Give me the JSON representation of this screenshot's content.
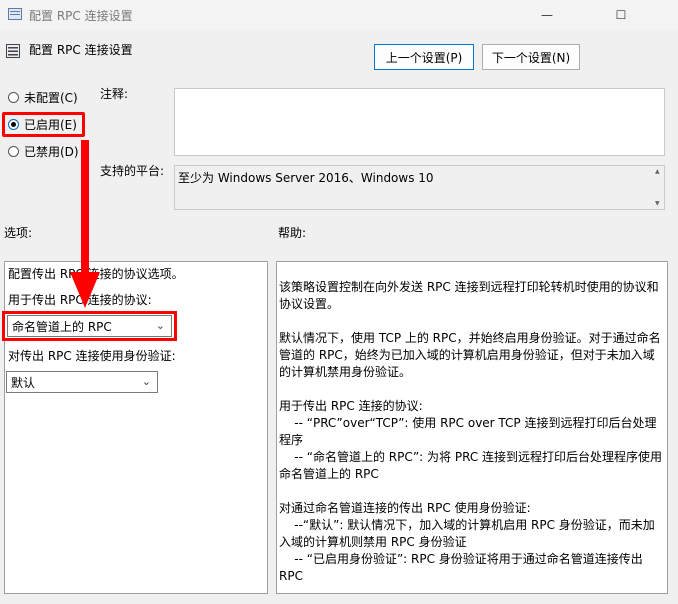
{
  "window": {
    "title": "配置 RPC 连接设置",
    "minimize_glyph": "—",
    "maximize_glyph": "☐"
  },
  "header": {
    "title": "配置 RPC 连接设置",
    "prev_button": "上一个设置(P)",
    "next_button": "下一个设置(N)"
  },
  "state": {
    "options": [
      {
        "label": "未配置(C)",
        "selected": false
      },
      {
        "label": "已启用(E)",
        "selected": true
      },
      {
        "label": "已禁用(D)",
        "selected": false
      }
    ]
  },
  "comment": {
    "label": "注释:",
    "value": ""
  },
  "platform": {
    "label": "支持的平台:",
    "value": "至少为 Windows Server 2016、Windows 10"
  },
  "options_panel": {
    "label": "选项:",
    "description": "配置传出 RPC 连接的协议选项。",
    "protocol_label": "用于传出 RPC 连接的协议:",
    "protocol_value": "命名管道上的 RPC",
    "auth_label": "对传出 RPC 连接使用身份验证:",
    "auth_value": "默认"
  },
  "help_panel": {
    "label": "帮助:",
    "text": "该策略设置控制在向外发送 RPC 连接到远程打印轮转机时使用的协议和协议设置。\n\n默认情况下，使用 TCP 上的 RPC，并始终启用身份验证。对于通过命名管道的 RPC，始终为已加入域的计算机启用身份验证，但对于未加入域的计算机禁用身份验证。\n\n用于传出 RPC 连接的协议:\n    -- “PRC”over“TCP”: 使用 RPC over TCP 连接到远程打印后台处理程序\n    -- “命名管道上的 RPC”: 为将 PRC 连接到远程打印后台处理程序使用命名管道上的 RPC\n\n对通过命名管道连接的传出 RPC 使用身份验证:\n    --“默认”: 默认情况下，加入域的计算机启用 RPC 身份验证，而未加入域的计算机则禁用 RPC 身份验证\n    -- “已启用身份验证”: RPC 身份验证将用于通过命名管道连接传出 RPC"
  },
  "colors": {
    "highlight": "#ff0000",
    "accent": "#0078d7"
  }
}
